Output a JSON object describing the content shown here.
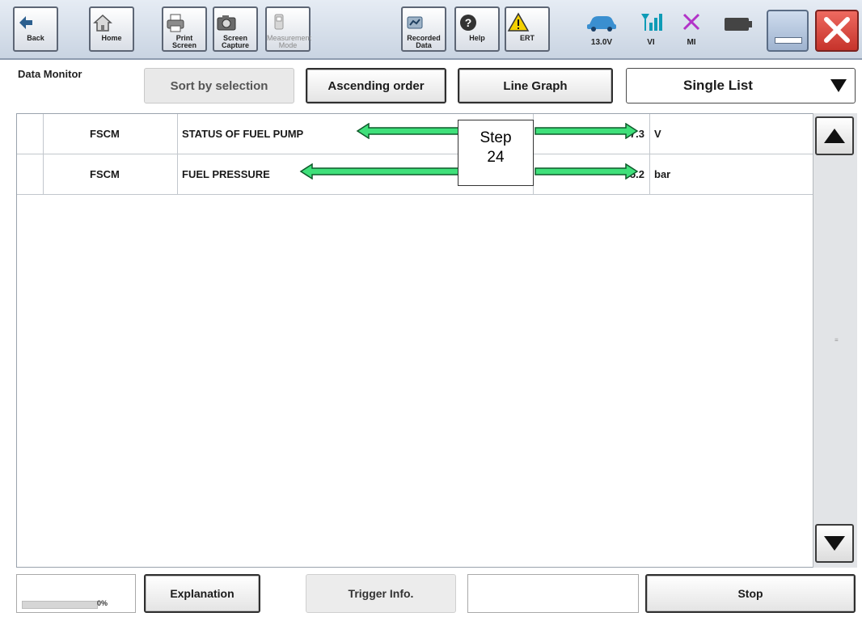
{
  "toolbar": {
    "back": "Back",
    "home": "Home",
    "print_screen": "Print Screen",
    "screen_capture": "Screen Capture",
    "measurement_mode": "Measurement Mode",
    "recorded_data": "Recorded Data",
    "help": "Help",
    "ert": "ERT",
    "voltage": "13.0V",
    "vi": "VI",
    "mi": "MI"
  },
  "header": {
    "title": "Data Monitor",
    "sort_by_selection": "Sort by selection",
    "ascending_order": "Ascending order",
    "line_graph": "Line Graph",
    "single_list": "Single List"
  },
  "rows": [
    {
      "system": "FSCM",
      "item": "STATUS OF FUEL PUMP",
      "value": "7.3",
      "unit": "V"
    },
    {
      "system": "FSCM",
      "item": "FUEL PRESSURE",
      "value": "5.2",
      "unit": "bar"
    }
  ],
  "callout": {
    "line1": "Step",
    "line2": "24"
  },
  "footer": {
    "progress": "0%",
    "explanation": "Explanation",
    "trigger_info": "Trigger Info.",
    "stop": "Stop"
  },
  "colors": {
    "arrow_fill": "#3fe07a",
    "arrow_stroke": "#0e5a2a",
    "close_red": "#d83c34"
  },
  "icons": [
    "back-icon",
    "home-icon",
    "printer-icon",
    "camera-icon",
    "measurement-icon",
    "recorded-data-icon",
    "help-icon",
    "warning-icon",
    "car-icon",
    "signal-icon",
    "mi-x-icon",
    "battery-icon",
    "minimize-icon",
    "close-icon",
    "scroll-up-icon",
    "scroll-down-icon",
    "dropdown-icon"
  ]
}
